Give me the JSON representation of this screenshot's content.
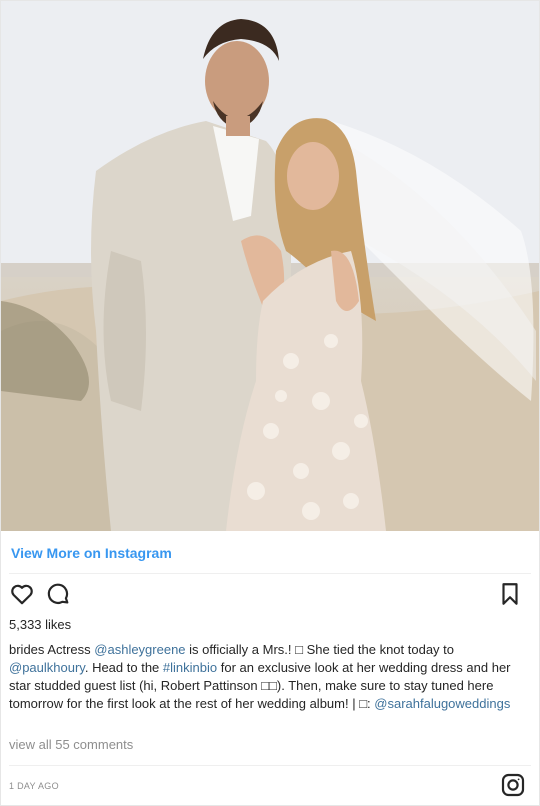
{
  "post": {
    "view_more": "View More on Instagram",
    "likes": "5,333 likes",
    "caption": {
      "username": "brides",
      "seg1": " Actress ",
      "mention1": "@ashleygreene",
      "seg2": " is officially a Mrs.! □ She tied the knot today to ",
      "mention2": "@paulkhoury",
      "seg3": ". Head to the ",
      "hashtag": "#linkinbio",
      "seg4": " for an exclusive look at her wedding dress and her star studded guest list (hi, Robert Pattinson □□). Then, make sure to stay tuned here tomorrow for the first look at the rest of her wedding album! | □: ",
      "mention3": "@sarahfalugoweddings"
    },
    "comments_link": "view all 55 comments",
    "timestamp": "1 DAY AGO"
  },
  "icons": {
    "like": "heart-icon",
    "comment": "comment-bubble-icon",
    "bookmark": "bookmark-icon",
    "instagram": "instagram-logo-icon"
  },
  "colors": {
    "link": "#3897f0",
    "mention": "#3f729b",
    "muted": "#8e8e8e",
    "text": "#262626"
  }
}
